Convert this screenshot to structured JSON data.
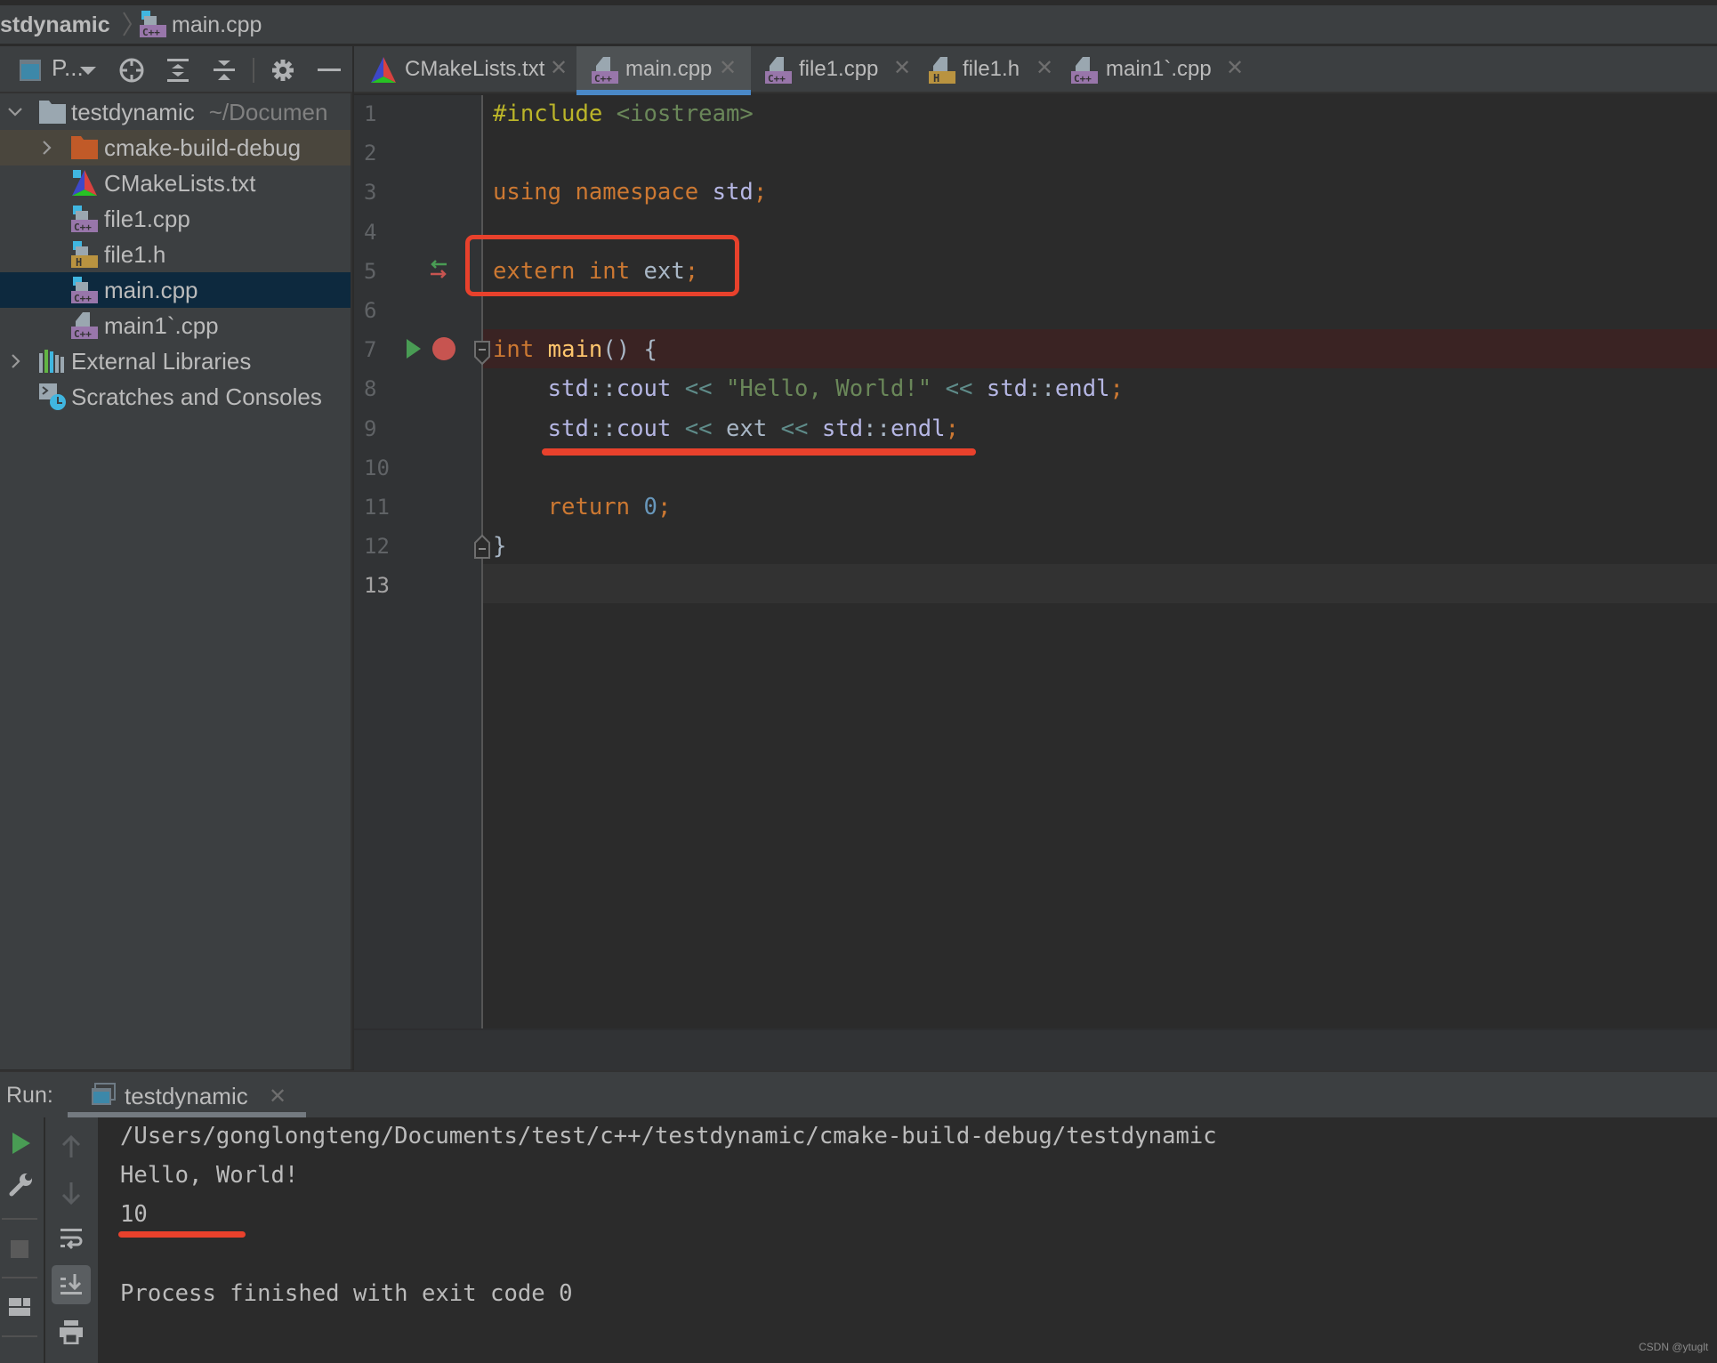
{
  "navbar": {
    "project": "stdynamic",
    "separator": "〉",
    "file": "main.cpp",
    "file_icon": "cpp-file-icon"
  },
  "project_toolbar": {
    "view_label": "P...",
    "icons": [
      "project-view-icon",
      "dropdown-arrow-icon",
      "locate-file-icon",
      "expand-all-icon",
      "collapse-all-icon",
      "gear-icon",
      "minimize-icon"
    ]
  },
  "project_tree": [
    {
      "label": "testdynamic",
      "sub": "~/Documen",
      "icon": "folder-icon",
      "expanded": true,
      "level": 0
    },
    {
      "label": "cmake-build-debug",
      "icon": "excluded-folder-icon",
      "expanded": false,
      "level": 1,
      "state": "excluded"
    },
    {
      "label": "CMakeLists.txt",
      "icon": "cmake-file-icon",
      "level": 1
    },
    {
      "label": "file1.cpp",
      "icon": "cpp-file-icon",
      "level": 1
    },
    {
      "label": "file1.h",
      "icon": "header-file-icon",
      "level": 1
    },
    {
      "label": "main.cpp",
      "icon": "cpp-file-icon",
      "level": 1,
      "state": "selected"
    },
    {
      "label": "main1`.cpp",
      "icon": "cpp-file-icon",
      "level": 1
    },
    {
      "label": "External Libraries",
      "icon": "library-icon",
      "expanded": false,
      "level": 0
    },
    {
      "label": "Scratches and Consoles",
      "icon": "scratches-icon",
      "level": 0
    }
  ],
  "editor_tabs": [
    {
      "label": "CMakeLists.txt",
      "icon": "cmake-file-icon",
      "active": false
    },
    {
      "label": "main.cpp",
      "icon": "cpp-file-icon",
      "active": true
    },
    {
      "label": "file1.cpp",
      "icon": "cpp-file-icon",
      "active": false
    },
    {
      "label": "file1.h",
      "icon": "header-file-icon",
      "active": false
    },
    {
      "label": "main1`.cpp",
      "icon": "cpp-file-icon",
      "active": false
    }
  ],
  "tab_close_glyph": "✕",
  "editor": {
    "line_numbers": [
      "1",
      "2",
      "3",
      "4",
      "5",
      "6",
      "7",
      "8",
      "9",
      "10",
      "11",
      "12",
      "13"
    ],
    "current_line": 13,
    "breakpoint_line": 7,
    "lines": [
      [
        {
          "t": "#include",
          "c": "pp"
        },
        {
          "t": " ",
          "c": "id"
        },
        {
          "t": "<iostream>",
          "c": "inc"
        }
      ],
      [],
      [
        {
          "t": "using",
          "c": "kw"
        },
        {
          "t": " ",
          "c": "id"
        },
        {
          "t": "namespace",
          "c": "kw"
        },
        {
          "t": " ",
          "c": "id"
        },
        {
          "t": "std",
          "c": "ns"
        },
        {
          "t": ";",
          "c": "semi"
        }
      ],
      [],
      [
        {
          "t": "extern",
          "c": "kw"
        },
        {
          "t": " ",
          "c": "id"
        },
        {
          "t": "int",
          "c": "kw"
        },
        {
          "t": " ext",
          "c": "id"
        },
        {
          "t": ";",
          "c": "semi"
        }
      ],
      [],
      [
        {
          "t": "int",
          "c": "kw"
        },
        {
          "t": " ",
          "c": "id"
        },
        {
          "t": "main",
          "c": "fn"
        },
        {
          "t": "() {",
          "c": "id"
        }
      ],
      [
        {
          "t": "    ",
          "c": "id"
        },
        {
          "t": "std",
          "c": "ns"
        },
        {
          "t": "::",
          "c": "id"
        },
        {
          "t": "cout",
          "c": "ns"
        },
        {
          "t": " ",
          "c": "id"
        },
        {
          "t": "<<",
          "c": "op"
        },
        {
          "t": " ",
          "c": "id"
        },
        {
          "t": "\"Hello, World!\"",
          "c": "str"
        },
        {
          "t": " ",
          "c": "id"
        },
        {
          "t": "<<",
          "c": "op"
        },
        {
          "t": " ",
          "c": "id"
        },
        {
          "t": "std",
          "c": "ns"
        },
        {
          "t": "::",
          "c": "id"
        },
        {
          "t": "endl",
          "c": "ns"
        },
        {
          "t": ";",
          "c": "semi"
        }
      ],
      [
        {
          "t": "    ",
          "c": "id"
        },
        {
          "t": "std",
          "c": "ns"
        },
        {
          "t": "::",
          "c": "id"
        },
        {
          "t": "cout",
          "c": "ns"
        },
        {
          "t": " ",
          "c": "id"
        },
        {
          "t": "<<",
          "c": "op"
        },
        {
          "t": " ext ",
          "c": "id"
        },
        {
          "t": "<<",
          "c": "op"
        },
        {
          "t": " ",
          "c": "id"
        },
        {
          "t": "std",
          "c": "ns"
        },
        {
          "t": "::",
          "c": "id"
        },
        {
          "t": "endl",
          "c": "ns"
        },
        {
          "t": ";",
          "c": "semi"
        }
      ],
      [],
      [
        {
          "t": "    ",
          "c": "id"
        },
        {
          "t": "return",
          "c": "kw"
        },
        {
          "t": " ",
          "c": "id"
        },
        {
          "t": "0",
          "c": "num"
        },
        {
          "t": ";",
          "c": "semi"
        }
      ],
      [
        {
          "t": "}",
          "c": "id"
        }
      ],
      []
    ],
    "gutter_icons": {
      "line_5": "declaration-navigation-icon",
      "line_7": [
        "run-gutter-icon",
        "breakpoint-icon"
      ]
    }
  },
  "annotations": {
    "color": "#e8412c",
    "boxed_line": 5,
    "underlined_code_line": 9,
    "underlined_output_line": 3
  },
  "run_panel": {
    "label": "Run:",
    "tab_label": "testdynamic",
    "console": [
      "/Users/gonglongteng/Documents/test/c++/testdynamic/cmake-build-debug/testdynamic",
      "Hello, World!",
      "10",
      "",
      "Process finished with exit code 0"
    ],
    "left_toolbar": [
      "rerun-icon",
      "wrench-icon",
      "stop-icon",
      "layout-icon"
    ],
    "right_toolbar": [
      "up-arrow-icon",
      "down-arrow-icon",
      "soft-wrap-icon",
      "scroll-to-end-icon",
      "print-icon"
    ]
  },
  "watermark": "CSDN @ytuglt",
  "colors": {
    "keyword": "#cc7832",
    "preprocessor": "#bbb529",
    "string": "#6a8759",
    "namespace": "#b5b6e3",
    "function": "#ffc66d",
    "number": "#6897bb",
    "active_tab_underline": "#4a88c7",
    "run_green": "#499c54",
    "breakpoint_red": "#c75450"
  }
}
